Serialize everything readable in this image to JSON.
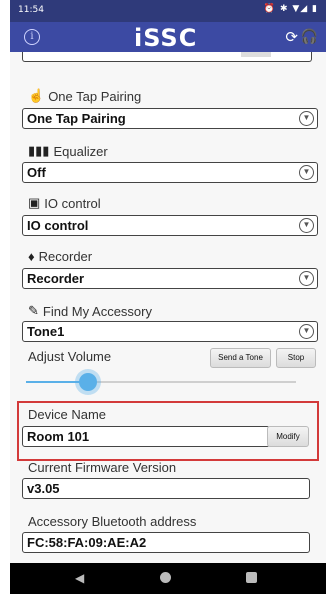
{
  "status": {
    "time": "11:54",
    "icons_text": "⏰ ✱ ▼◢ ▮"
  },
  "appbar": {
    "logo": "iSSC",
    "info_icon": "info-icon",
    "sync_icon": "sync-icon",
    "headset_icon": "headset-icon"
  },
  "sections": {
    "one_tap": {
      "label": "One Tap Pairing",
      "value": "One Tap Pairing",
      "icon": "hand-tap-icon"
    },
    "equalizer": {
      "label": "Equalizer",
      "value": "Off",
      "icon": "equalizer-icon"
    },
    "io": {
      "label": "IO control",
      "value": "IO control",
      "icon": "io-control-icon"
    },
    "recorder": {
      "label": "Recorder",
      "value": "Recorder",
      "icon": "microphone-icon"
    },
    "find": {
      "label": "Find My Accessory",
      "value": "Tone1",
      "icon": "key-tag-icon"
    }
  },
  "volume": {
    "label": "Adjust Volume",
    "send_tone": "Send a Tone",
    "stop": "Stop",
    "level": 0.23
  },
  "device_name": {
    "label": "Device Name",
    "value": "Room 101",
    "modify": "Modify"
  },
  "firmware": {
    "label": "Current Firmware Version",
    "value": "v3.05"
  },
  "bt_address": {
    "label": "Accessory Bluetooth address",
    "value": "FC:58:FA:09:AE:A2"
  },
  "colors": {
    "appbar": "#3c4aa3",
    "statusbar": "#2f3a7a",
    "accent": "#5ab0e8",
    "highlight": "#d33a3a"
  }
}
